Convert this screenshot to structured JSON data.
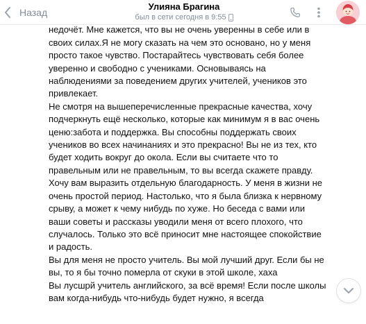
{
  "header": {
    "back_label": "Назад",
    "contact_name": "Улияна Брагина",
    "last_seen": "был в сети сегодня в 9:55"
  },
  "message": {
    "paragraphs": [
      "язык не поворачивается назвать его минусом, так, скорее, недочёт. Мне кажется, что вы не очень уверенны в себе или в своих силах.Я не могу сказать на чем это основано, но у меня просто такое чувство. Постарайтесь чувствовать себя более уверенно и свободно с учениками. Основываясь на наблюдениями за поведением других учителей, учеников это привлекает.",
      "Не смотря на вышеперечисленные прекрасные качества, хочу подчеркнуть ещё несколько, которые как минимум я в вас очень ценю:забота и поддержка. Вы способны поддержать своих учеников во всех начинаниях и это прекрасно! Вы не из тех, кто будет ходить вокруг до окола. Если вы считаете что то правельным или не правельным, то вы всегда скажете правду.",
      "Хочу вам выразить отдельную благодарность. У меня в жизни не очень простой период. Настолько, что я была близка к нервному срыву, а может к чему нибудь по хуже. Но беседа с вами или ваши советы и рассказы уводили меня от всего плохого, что случалось. Только это всё приносит мне настоящее спокойствие и радость.",
      "Вы для меня не просто учитель. Вы мой лучший друг. Если бы не вы, то я бы точно померла от скуки в этой школе, хаха",
      "Вы лусшрй учитель английского, за всё время! Если после школы вам когда-нибудь что-нибудь будет нужно, я всегда"
    ]
  },
  "colors": {
    "accent": "#818c99",
    "text": "#111111",
    "background": "#ffffff"
  }
}
